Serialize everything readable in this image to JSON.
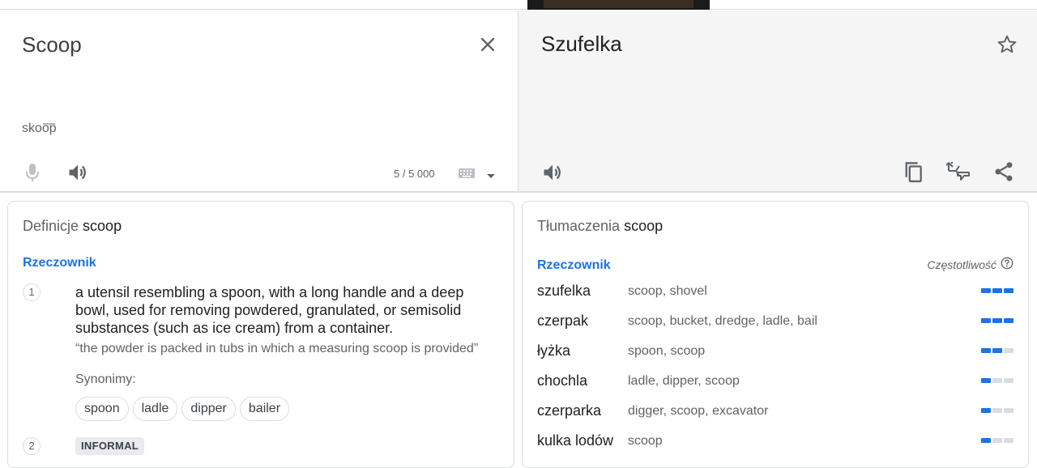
{
  "colors": {
    "accent": "#1a73e8",
    "inactive_segment": "#dadce0"
  },
  "source": {
    "text": "Scoop",
    "transliteration": "skoo͞p",
    "char_count": "5 / 5 000",
    "icons": {
      "clear": "close-icon",
      "mic": "mic-icon",
      "speaker": "volume-icon",
      "keyboard": "keyboard-icon",
      "dropdown": "caret-down-icon"
    }
  },
  "target": {
    "text": "Szufelka",
    "icons": {
      "star": "star-icon",
      "speaker": "volume-icon",
      "copy": "copy-icon",
      "feedback": "feedback-icon",
      "share": "share-icon"
    }
  },
  "definitions": {
    "title_prefix": "Definicje",
    "title_word": "scoop",
    "part_of_speech": "Rzeczownik",
    "entries": [
      {
        "number": "1",
        "text": "a utensil resembling a spoon, with a long handle and a deep bowl, used for removing powdered, granulated, or semisolid substances (such as ice cream) from a container.",
        "example": "“the powder is packed in tubs in which a measuring scoop is provided”",
        "synonyms_label": "Synonimy:",
        "synonyms": [
          "spoon",
          "ladle",
          "dipper",
          "bailer"
        ]
      },
      {
        "number": "2",
        "badge": "INFORMAL"
      }
    ]
  },
  "translations": {
    "title_prefix": "Tłumaczenia",
    "title_word": "scoop",
    "part_of_speech": "Rzeczownik",
    "frequency_label": "Częstotliwość",
    "rows": [
      {
        "word": "szufelka",
        "reverse": "scoop, shovel",
        "frequency": 3
      },
      {
        "word": "czerpak",
        "reverse": "scoop, bucket, dredge, ladle, bail",
        "frequency": 3
      },
      {
        "word": "łyżka",
        "reverse": "spoon, scoop",
        "frequency": 2
      },
      {
        "word": "chochla",
        "reverse": "ladle, dipper, scoop",
        "frequency": 1
      },
      {
        "word": "czerparka",
        "reverse": "digger, scoop, excavator",
        "frequency": 1
      },
      {
        "word": "kulka lodów",
        "reverse": "scoop",
        "frequency": 1
      }
    ]
  }
}
